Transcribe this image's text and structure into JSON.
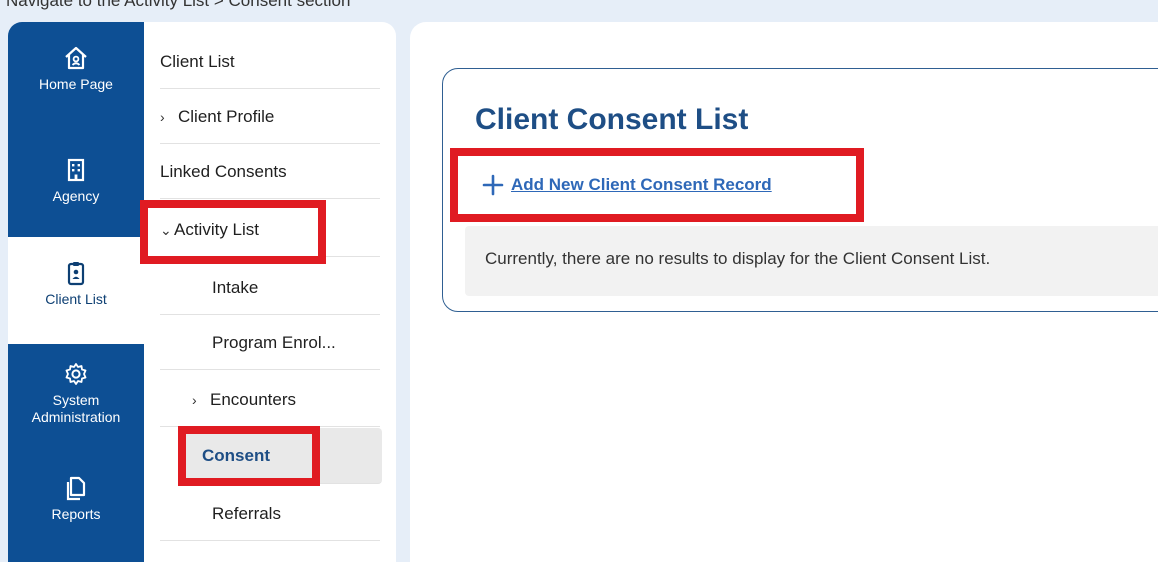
{
  "caption": "Navigate to the Activity List > Consent section",
  "leftnav": {
    "items": [
      {
        "label": "Home Page",
        "icon": "home-icon"
      },
      {
        "label": "Agency",
        "icon": "building-icon"
      },
      {
        "label": "Client List",
        "icon": "clipboard-person-icon"
      },
      {
        "label": "System Administration",
        "icon": "gear-icon"
      },
      {
        "label": "Reports",
        "icon": "document-copy-icon"
      }
    ],
    "active": "Client List"
  },
  "subnav": {
    "items": [
      {
        "label": "Client List"
      },
      {
        "label": "Client Profile",
        "chevron": "›"
      },
      {
        "label": "Linked Consents"
      },
      {
        "label": "Activity List",
        "chevron": "⌄"
      },
      {
        "label": "Intake"
      },
      {
        "label": "Program Enrol..."
      },
      {
        "label": "Encounters",
        "chevron": "›"
      },
      {
        "label": "Consent"
      },
      {
        "label": "Referrals"
      }
    ],
    "selected": "Consent"
  },
  "main": {
    "title": "Client Consent List",
    "add_link": "Add New Client Consent Record",
    "empty_message": "Currently, there are no results to display for the Client Consent List."
  },
  "colors": {
    "nav_blue": "#0d4f94",
    "title_blue": "#1e4e85",
    "link_blue": "#2e68b8",
    "highlight_red": "#e01b22"
  }
}
